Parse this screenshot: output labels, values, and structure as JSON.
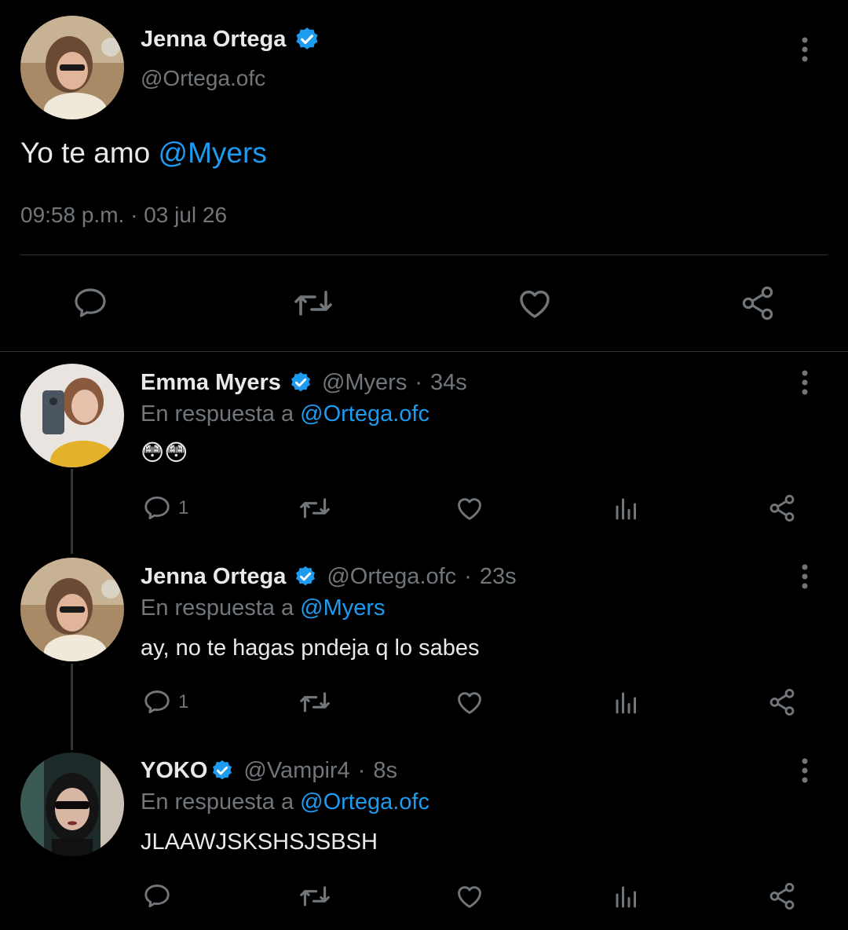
{
  "main_tweet": {
    "name": "Jenna Ortega",
    "handle": "@Ortega.ofc",
    "text_plain": "Yo te amo ",
    "text_mention": "@Myers",
    "time": "09:58 p.m.",
    "separator": " · ",
    "date": "03 jul 26"
  },
  "replies": [
    {
      "name": "Emma Myers",
      "handle": "@Myers",
      "time": "34s",
      "reply_prefix": "En respuesta a ",
      "reply_to": "@Ortega.ofc",
      "text": "😳😳",
      "reply_count": "1"
    },
    {
      "name": "Jenna Ortega",
      "handle": "@Ortega.ofc",
      "time": "23s",
      "reply_prefix": "En respuesta a ",
      "reply_to": "@Myers",
      "text": "ay, no te hagas pndeja q lo sabes",
      "reply_count": "1"
    },
    {
      "name": "YOKO",
      "handle": "@Vampir4",
      "time": "8s",
      "reply_prefix": "En respuesta a ",
      "reply_to": "@Ortega.ofc",
      "text": "JLAAWJSKSHSJSBSH",
      "reply_count": ""
    }
  ],
  "separator_dot": "·",
  "colors": {
    "background": "#000000",
    "text": "#e7e9ea",
    "muted": "#71767b",
    "accent": "#1d9bf0"
  }
}
